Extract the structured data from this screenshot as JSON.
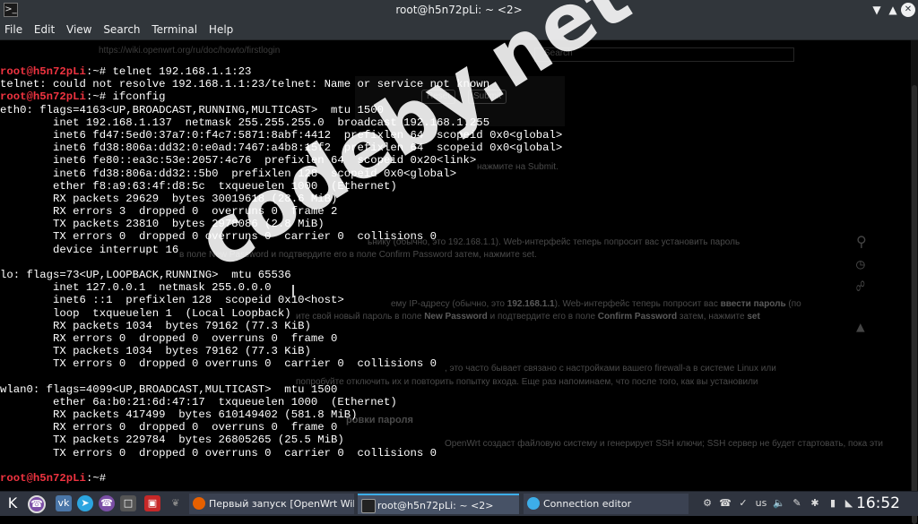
{
  "window": {
    "title": "root@h5n72pLi: ~ <2>"
  },
  "menu": [
    "File",
    "Edit",
    "View",
    "Search",
    "Terminal",
    "Help"
  ],
  "terminal": {
    "lines": [
      {
        "prompt": "root@h5n72pLi",
        "text": ":~# telnet 192.168.1.1:23"
      },
      {
        "prompt": "",
        "text": "telnet: could not resolve 192.168.1.1:23/telnet: Name or service not known"
      },
      {
        "prompt": "root@h5n72pLi",
        "text": ":~# ifconfig"
      },
      {
        "prompt": "",
        "text": "eth0: flags=4163<UP,BROADCAST,RUNNING,MULTICAST>  mtu 1500"
      },
      {
        "prompt": "",
        "text": "        inet 192.168.1.137  netmask 255.255.255.0  broadcast 192.168.1.255"
      },
      {
        "prompt": "",
        "text": "        inet6 fd47:5ed0:37a7:0:f4c7:5871:8abf:4412  prefixlen 64  scopeid 0x0<global>"
      },
      {
        "prompt": "",
        "text": "        inet6 fd38:806a:dd32:0:e0ad:7467:a4b8:15f2  prefixlen 64  scopeid 0x0<global>"
      },
      {
        "prompt": "",
        "text": "        inet6 fe80::ea3c:53e:2057:4c76  prefixlen 64  scopeid 0x20<link>"
      },
      {
        "prompt": "",
        "text": "        inet6 fd38:806a:dd32::5b0  prefixlen 128  scopeid 0x0<global>"
      },
      {
        "prompt": "",
        "text": "        ether f8:a9:63:4f:d8:5c  txqueuelen 1000  (Ethernet)"
      },
      {
        "prompt": "",
        "text": "        RX packets 29629  bytes 30019618 (28.6 MiB)"
      },
      {
        "prompt": "",
        "text": "        RX errors 3  dropped 0  overruns 0  frame 2"
      },
      {
        "prompt": "",
        "text": "        TX packets 23810  bytes 2978086 (2.8 MiB)"
      },
      {
        "prompt": "",
        "text": "        TX errors 0  dropped 0 overruns 0  carrier 0  collisions 0"
      },
      {
        "prompt": "",
        "text": "        device interrupt 16"
      },
      {
        "prompt": "",
        "text": ""
      },
      {
        "prompt": "",
        "text": "lo: flags=73<UP,LOOPBACK,RUNNING>  mtu 65536"
      },
      {
        "prompt": "",
        "text": "        inet 127.0.0.1  netmask 255.0.0.0"
      },
      {
        "prompt": "",
        "text": "        inet6 ::1  prefixlen 128  scopeid 0x10<host>"
      },
      {
        "prompt": "",
        "text": "        loop  txqueuelen 1  (Local Loopback)"
      },
      {
        "prompt": "",
        "text": "        RX packets 1034  bytes 79162 (77.3 KiB)"
      },
      {
        "prompt": "",
        "text": "        RX errors 0  dropped 0  overruns 0  frame 0"
      },
      {
        "prompt": "",
        "text": "        TX packets 1034  bytes 79162 (77.3 KiB)"
      },
      {
        "prompt": "",
        "text": "        TX errors 0  dropped 0 overruns 0  carrier 0  collisions 0"
      },
      {
        "prompt": "",
        "text": ""
      },
      {
        "prompt": "",
        "text": "wlan0: flags=4099<UP,BROADCAST,MULTICAST>  mtu 1500"
      },
      {
        "prompt": "",
        "text": "        ether 6a:b0:21:6d:47:17  txqueuelen 1000  (Ethernet)"
      },
      {
        "prompt": "",
        "text": "        RX packets 417499  bytes 610149402 (581.8 MiB)"
      },
      {
        "prompt": "",
        "text": "        RX errors 0  dropped 0  overruns 0  frame 0"
      },
      {
        "prompt": "",
        "text": "        TX packets 229784  bytes 26805265 (25.5 MiB)"
      },
      {
        "prompt": "",
        "text": "        TX errors 0  dropped 0 overruns 0  carrier 0  collisions 0"
      },
      {
        "prompt": "",
        "text": ""
      },
      {
        "prompt": "root@h5n72pLi",
        "text": ":~# "
      }
    ]
  },
  "background_page": {
    "url": "https://wiki.openwrt.org/ru/doc/howto/firstlogin",
    "search_placeholder": "Search",
    "reset_label": "Reset",
    "submit_label": "Submit",
    "text1": "нажмите на Submit.",
    "text2": "ьнику (обычно, это 192.168.1.1). Web-интерфейс теперь попросит вас установить пароль",
    "text3": "в поле New Password и подтвердите его в поле Confirm Password затем, нажмите set.",
    "text4a": "ему IP-адресу (обычно, это ",
    "text4b": "192.168.1.1",
    "text4c": "). Web-интерфейс теперь попросит вас ",
    "text4d": "ввести пароль",
    "text4e": " (по",
    "text5a": "ите свой новый пароль в поле ",
    "text5b": "New Password",
    "text5c": " и подтвердите его в поле ",
    "text5d": "Confirm Password",
    "text5e": " затем, нажмите ",
    "text5f": "set",
    "text6": ", это часто бывает связано с настройками вашего firewall-а в системе Linux или",
    "text7": "попробуйте отключить их и повторить попытку входа. Еще раз напоминаем, что после того, как вы установили",
    "text8": "ровки пароля",
    "text9": "OpenWrt создаст файловую систему и генерирует SSH ключи; SSH сервер не будет стартовать, пока эти"
  },
  "watermark": "codeby.net",
  "taskbar": {
    "tasks": [
      {
        "label": "Первый запуск [OpenWrt Wiki] - ..."
      },
      {
        "label": "root@h5n72pLi: ~ <2>"
      },
      {
        "label": "Connection editor"
      }
    ],
    "keyboard_layout": "us",
    "clock": "16:52"
  },
  "colors": {
    "prompt": "#ef3340",
    "terminal_bg": "#000000",
    "panel_bg": "#2f343f",
    "titlebar_bg": "#31363b",
    "accent": "#3daee9"
  }
}
